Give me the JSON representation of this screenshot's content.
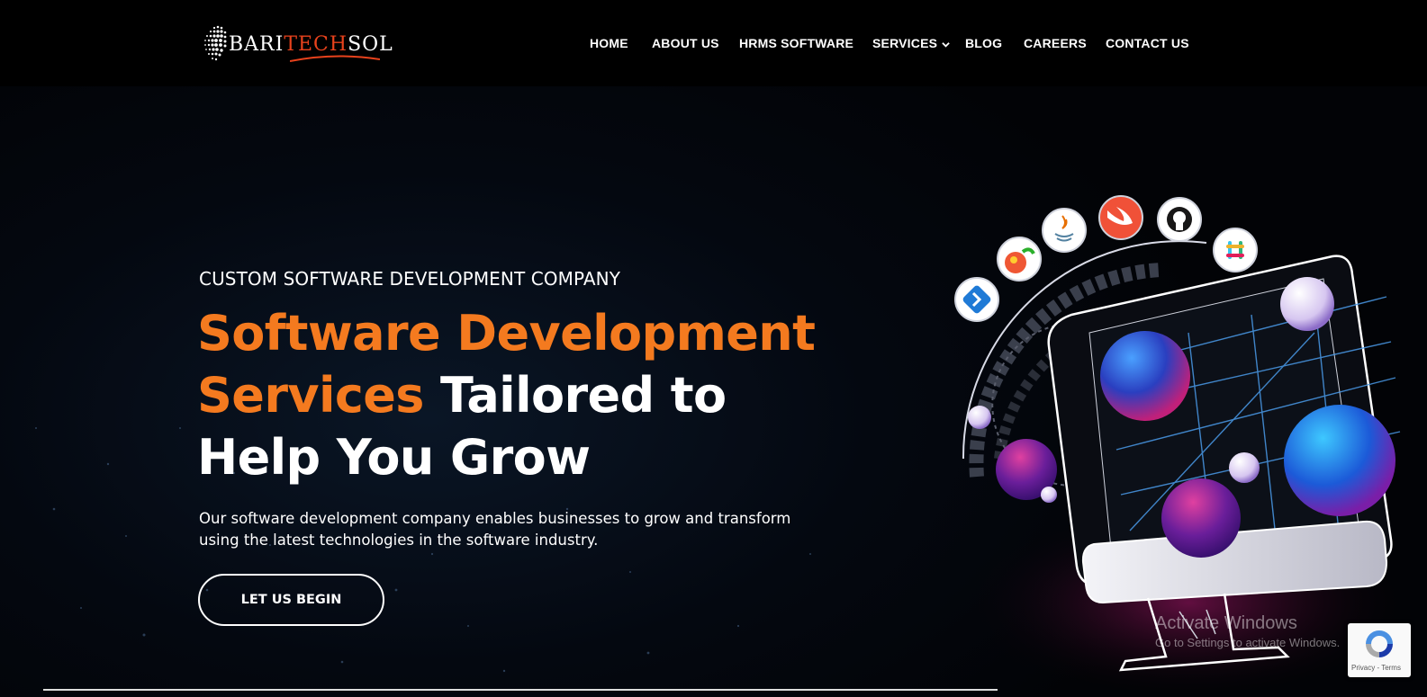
{
  "brand": {
    "name_part1": "Bari",
    "name_part2": "Tech",
    "name_part3": "Sol"
  },
  "nav": {
    "items": [
      {
        "label": "HOME"
      },
      {
        "label": "ABOUT US"
      },
      {
        "label": "HRMS SOFTWARE"
      },
      {
        "label": "SERVICES",
        "icon": "chevron-down-icon"
      },
      {
        "label": "BLOG"
      },
      {
        "label": "CAREERS"
      },
      {
        "label": "CONTACT US"
      }
    ]
  },
  "hero": {
    "eyebrow": "CUSTOM SOFTWARE DEVELOPMENT COMPANY",
    "headline_accent": "Software Development Services",
    "headline_rest": "Tailored to Help You Grow",
    "description": "Our software development company enables businesses to grow and transform using the latest technologies in the software industry.",
    "cta_label": "LET US BEGIN"
  },
  "illustration": {
    "tech_icons": [
      "dev-tool-icon",
      "bower-icon",
      "java-icon",
      "swift-icon",
      "github-icon",
      "slack-icon"
    ]
  },
  "watermark": {
    "title": "Activate Windows",
    "subtitle": "Go to Settings to activate Windows."
  },
  "recaptcha": {
    "links": "Privacy - Terms"
  },
  "colors": {
    "accent": "#f47a1f",
    "logo_accent": "#e8421c",
    "header_bg": "#000000",
    "page_bg": "#03050a"
  }
}
